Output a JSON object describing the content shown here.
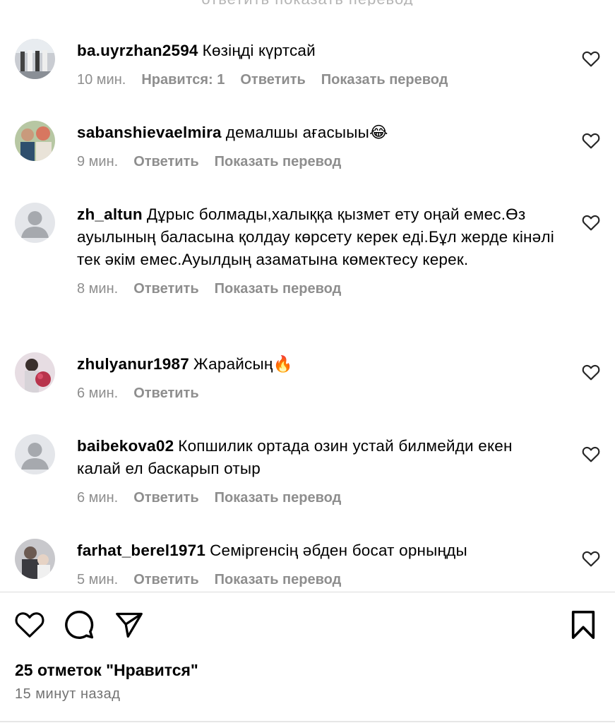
{
  "cut_text": "ответить показать перевод",
  "comments": [
    {
      "username": "ba.uyrzhan2594",
      "text": "Көзіңді күртсай",
      "time": "10 мин.",
      "likes": "Нравится: 1",
      "reply": "Ответить",
      "translate": "Показать перевод"
    },
    {
      "username": "sabanshievaelmira",
      "text": "демалшы ағасыыы😂",
      "time": "9 мин.",
      "reply": "Ответить",
      "translate": "Показать перевод"
    },
    {
      "username": "zh_altun",
      "text": "Дұрыс болмады,халыққа қызмет ету оңай емес.Өз ауылының баласына қолдау көрсету керек еді.Бұл жерде кінәлі тек әкім емес.Ауылдың азаматына көмектесу керек.",
      "time": "8 мин.",
      "reply": "Ответить",
      "translate": "Показать перевод"
    },
    {
      "username": "zhulyanur1987",
      "text": "Жарайсың🔥",
      "time": "6 мин.",
      "reply": "Ответить"
    },
    {
      "username": "baibekova02",
      "text": "Копшилик ортада озин устай билмейди екен калай ел баскарып отыр",
      "time": "6 мин.",
      "reply": "Ответить",
      "translate": "Показать перевод"
    },
    {
      "username": "farhat_berel1971",
      "text": "Семіргенсің әбден босат орныңды",
      "time": "5 мин.",
      "reply": "Ответить",
      "translate": "Показать перевод"
    }
  ],
  "likes_count": "25 отметок \"Нравится\"",
  "posted_time": "15 минут назад",
  "icons": {
    "like": "heart-outline-icon",
    "comment": "comment-bubble-icon",
    "share": "paper-plane-icon",
    "save": "bookmark-icon"
  }
}
